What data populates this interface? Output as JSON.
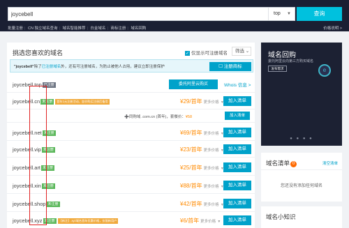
{
  "search": {
    "query": "joycebell",
    "tld": "top",
    "button": "查询"
  },
  "subnav": {
    "items": [
      "批量注册",
      "CN 独立域名查询",
      "域名智能推荐",
      "白金域名",
      "商标注册",
      "域名回购"
    ],
    "price_link": "价格说明 >"
  },
  "panel": {
    "title": "挑选您喜欢的域名",
    "only_unregistered": "仅显示可注册域名",
    "filter": "筛选 ⌄"
  },
  "notice": {
    "prefix": "\"joycebell\"",
    "middle": "除了",
    "highlight": "已注册域名",
    "suffix": "外，还有可注册域名，为防止被他人占用，建议立即注册保护",
    "button": "☐ 注册商标"
  },
  "rows": [
    {
      "name": "joycebell.top",
      "status": "已注册",
      "status_type": "reg",
      "whois_button": "委托阿里云购买",
      "whois_link": "Whois 信息 >"
    },
    {
      "name": "joycebell.cn",
      "status": "未注册",
      "status_type": "free",
      "promo": "首年1元注册活动，加价购买注册后备用",
      "price": "¥29/首年",
      "more": "更多价格",
      "button": "加入清单"
    },
    {
      "name": "joycebell.net",
      "status": "未注册",
      "status_type": "free",
      "price": "¥69/首年",
      "more": "更多价格",
      "button": "加入清单"
    },
    {
      "name": "joycebell.vip",
      "status": "未注册",
      "status_type": "free",
      "price": "¥23/首年",
      "more": "更多价格",
      "button": "加入清单"
    },
    {
      "name": "joycebell.art",
      "status": "未注册",
      "status_type": "free",
      "price": "¥25/首年",
      "more": "更多价格",
      "button": "加入清单"
    },
    {
      "name": "joycebell.xin",
      "status": "未注册",
      "status_type": "free",
      "price": "¥88/首年",
      "more": "更多价格",
      "button": "加入清单"
    },
    {
      "name": "joycebell.shop",
      "status": "未注册",
      "status_type": "free",
      "price": "¥42/首年",
      "more": "更多价格",
      "button": "加入清单"
    },
    {
      "name": "joycebell.xyz",
      "status": "未注册",
      "status_type": "free",
      "promo": "【新注】.xyz域名首年优惠价格，仅限新用户",
      "price": "¥6/首年",
      "more": "更多价格",
      "button": "加入清单"
    }
  ],
  "subrow": {
    "text_prefix": "➕同购域 .com.cn (首年)，套餐价：",
    "text_price": "¥58",
    "button": "加入清单"
  },
  "banner": {
    "title": "域名回购",
    "subtitle": "委托阿里云向第三方购买域名",
    "button": "发布需求",
    "coin": "e",
    "dots": "● ● ● ●"
  },
  "cart": {
    "title": "域名清单",
    "badge": "0",
    "link": "清空清单",
    "empty": "您还没有添加任何域名"
  },
  "knowledge": {
    "title": "域名小知识"
  }
}
